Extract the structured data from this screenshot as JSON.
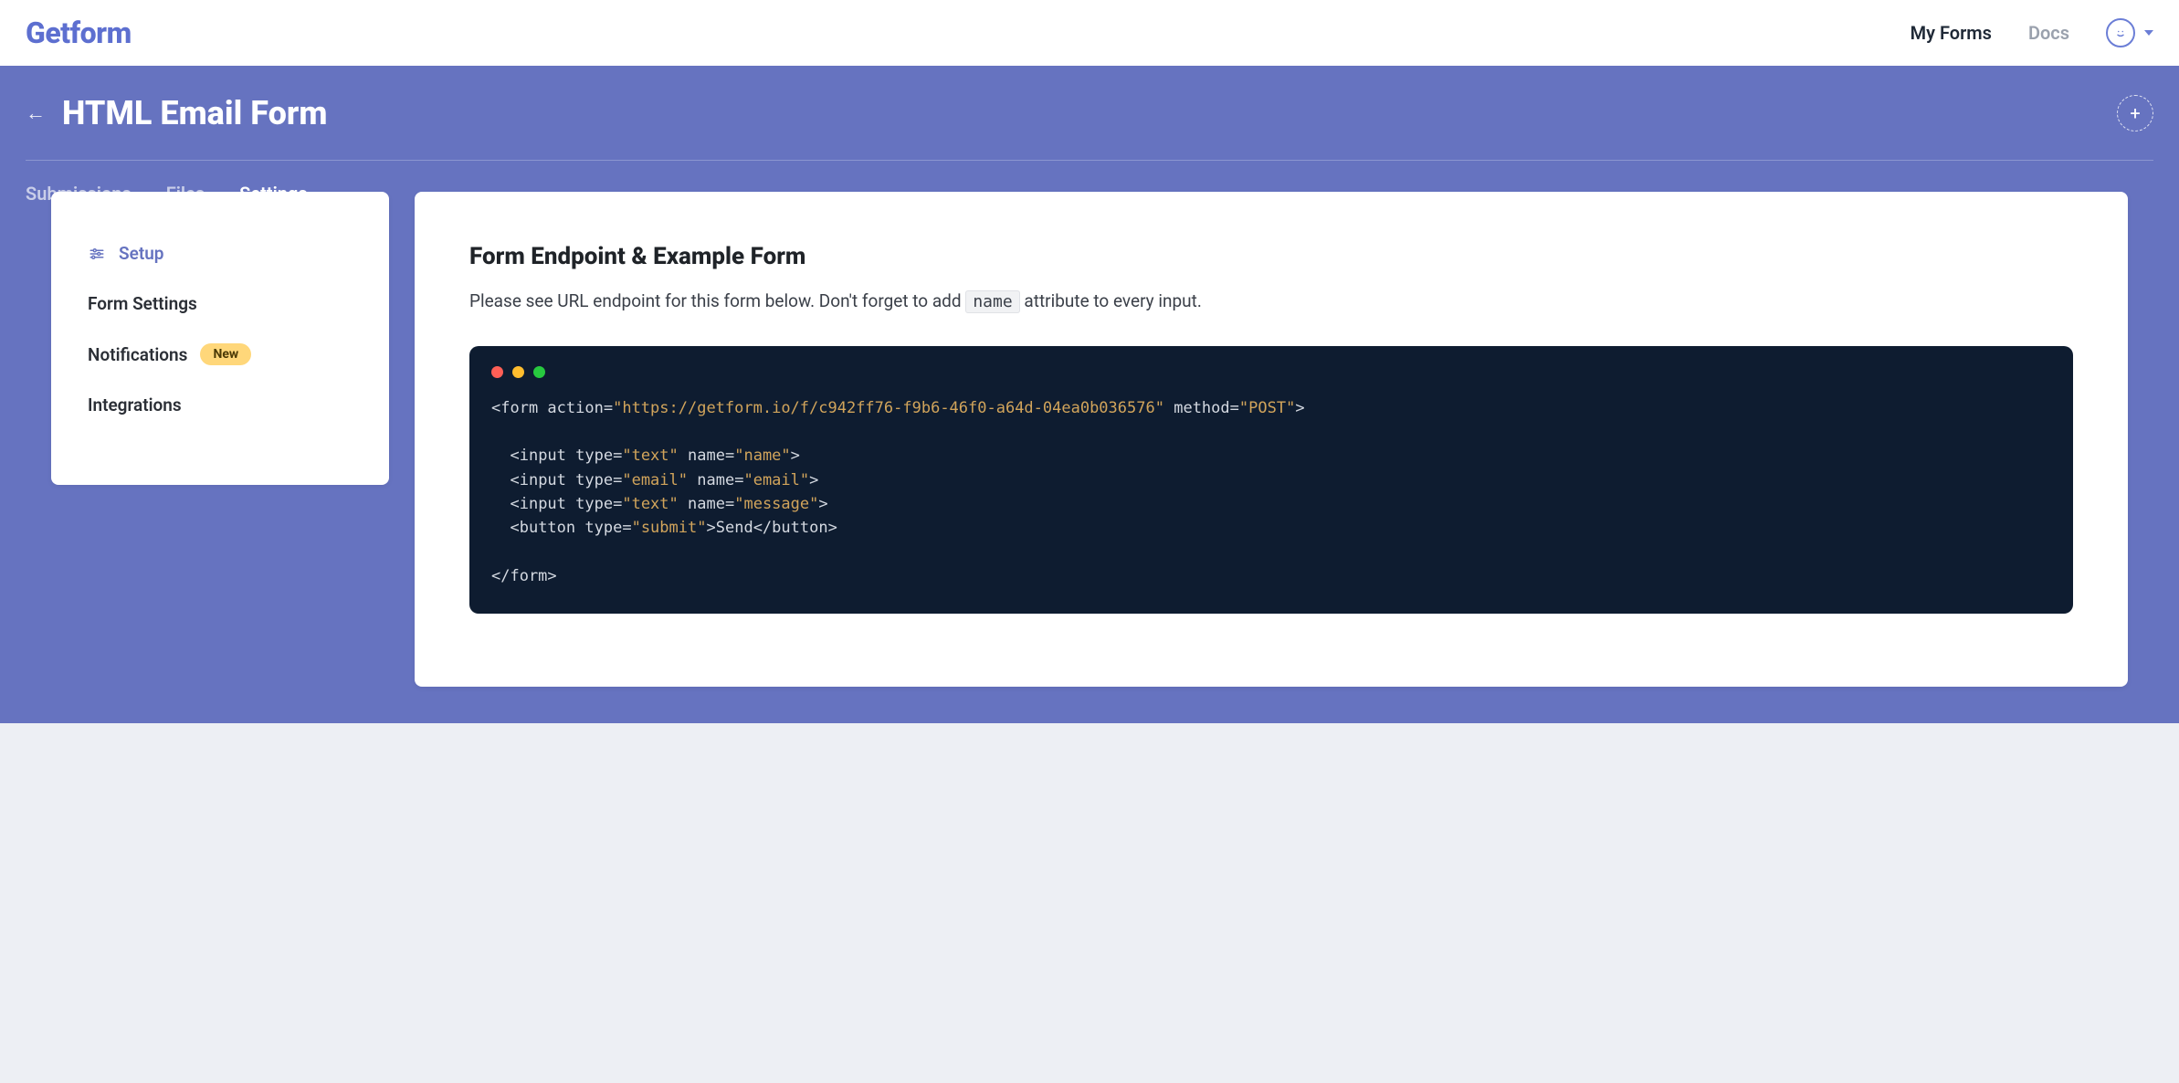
{
  "brand": "Getform",
  "topnav": {
    "my_forms": "My Forms",
    "docs": "Docs"
  },
  "header": {
    "title": "HTML Email Form"
  },
  "tabs": {
    "submissions": "Submissions",
    "files": "Files",
    "settings": "Settings",
    "active": "settings"
  },
  "sidebar": {
    "items": [
      {
        "key": "setup",
        "label": "Setup",
        "active": true
      },
      {
        "key": "form-settings",
        "label": "Form Settings",
        "active": false
      },
      {
        "key": "notifications",
        "label": "Notifications",
        "active": false,
        "badge": "New"
      },
      {
        "key": "integrations",
        "label": "Integrations",
        "active": false
      }
    ]
  },
  "main": {
    "heading": "Form Endpoint & Example Form",
    "desc_before": "Please see URL endpoint for this form below. Don't forget to add ",
    "desc_code": "name",
    "desc_after": " attribute to every input.",
    "code": {
      "action_url": "https://getform.io/f/c942ff76-f9b6-46f0-a64d-04ea0b036576",
      "method": "POST",
      "inputs": [
        {
          "type": "text",
          "name": "name"
        },
        {
          "type": "email",
          "name": "email"
        },
        {
          "type": "text",
          "name": "message"
        }
      ],
      "button_type": "submit",
      "button_text": "Send"
    }
  }
}
